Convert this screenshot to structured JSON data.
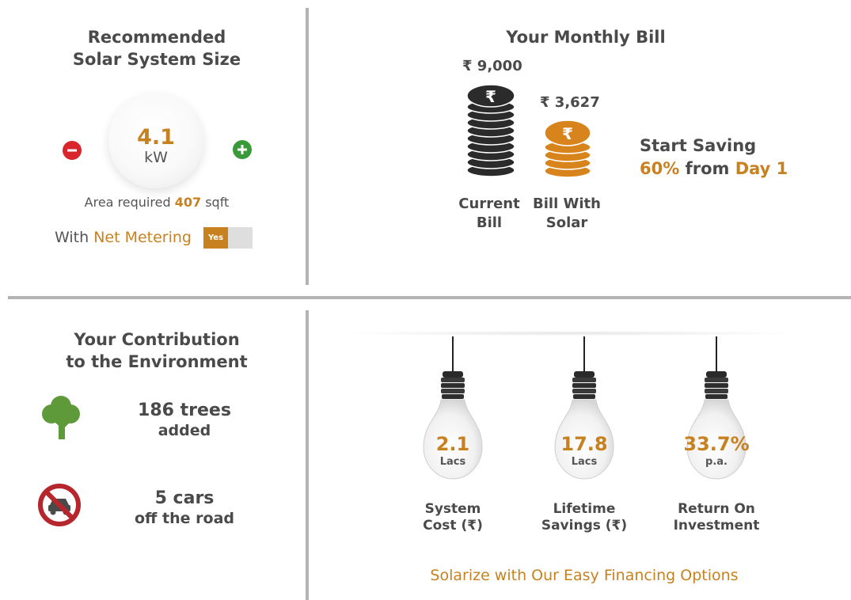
{
  "system_size": {
    "title_line1": "Recommended",
    "title_line2": "Solar System Size",
    "value": "4.1",
    "unit": "kW",
    "area_prefix": "Area required",
    "area_value": "407",
    "area_suffix": "sqft",
    "net_metering_prefix": "With",
    "net_metering_label": "Net Metering",
    "toggle_label": "Yes"
  },
  "monthly_bill": {
    "title": "Your Monthly Bill",
    "current_amount": "₹ 9,000",
    "solar_amount": "₹ 3,627",
    "current_label_line1": "Current",
    "current_label_line2": "Bill",
    "solar_label_line1": "Bill With",
    "solar_label_line2": "Solar",
    "saving_line1": "Start Saving",
    "saving_percent": "60%",
    "saving_from": "from",
    "saving_day": "Day 1"
  },
  "environment": {
    "title_line1": "Your Contribution",
    "title_line2": "to the Environment",
    "trees_main": "186 trees",
    "trees_sub": "added",
    "cars_main": "5 cars",
    "cars_sub": "off the road"
  },
  "financials": {
    "bulbs": [
      {
        "value": "2.1",
        "unit": "Lacs",
        "label_line1": "System",
        "label_line2": "Cost (₹)"
      },
      {
        "value": "17.8",
        "unit": "Lacs",
        "label_line1": "Lifetime",
        "label_line2": "Savings (₹)"
      },
      {
        "value": "33.7%",
        "unit": "p.a.",
        "label_line1": "Return On",
        "label_line2": "Investment"
      }
    ],
    "financing_link": "Solarize with Our Easy Financing Options"
  },
  "colors": {
    "accent": "#c8811f",
    "divider": "#b3b3b3",
    "text": "#4a4a4a",
    "minus_button": "#d9262b",
    "plus_button": "#3a9a3a",
    "tree": "#5e9a3a",
    "no_car_sign": "#b5272d"
  }
}
